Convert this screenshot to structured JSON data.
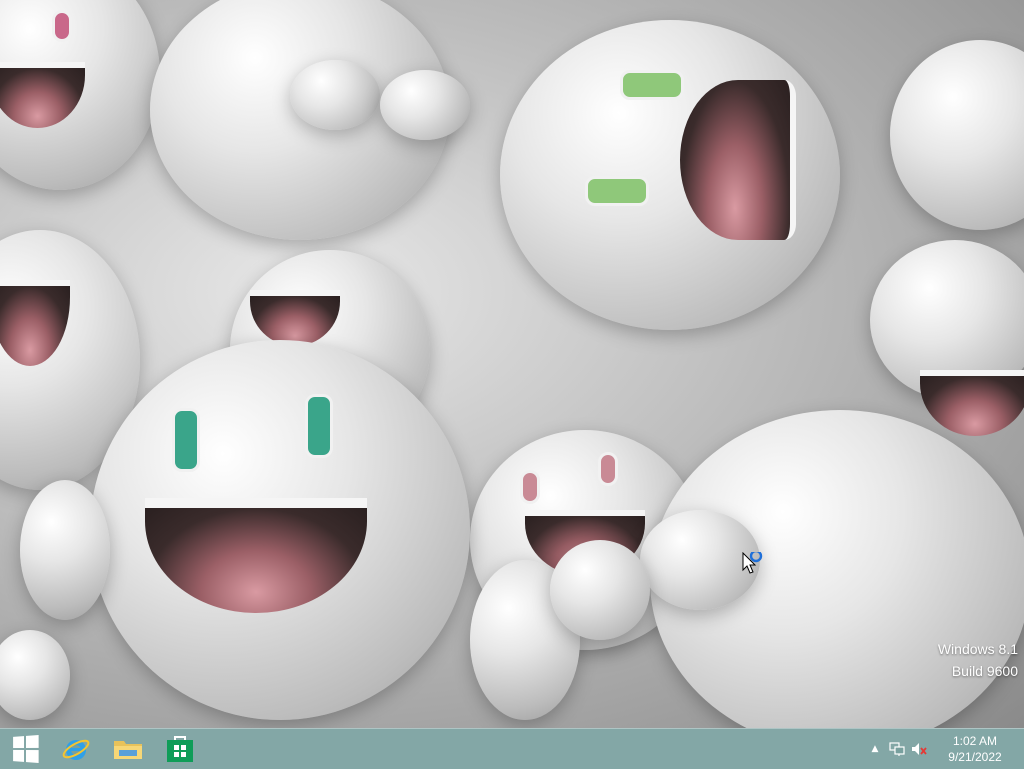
{
  "desktop": {
    "wallpaper": "white-glossy-figures-wallpaper",
    "watermark": {
      "line1": "Windows 8.1",
      "line2": "Build 9600"
    }
  },
  "taskbar": {
    "color": "#78a09e",
    "pinned": [
      {
        "name": "start-button",
        "icon": "windows-logo-icon"
      },
      {
        "name": "internet-explorer",
        "icon": "internet-explorer-icon"
      },
      {
        "name": "file-explorer",
        "icon": "folder-icon"
      },
      {
        "name": "store",
        "icon": "store-icon"
      }
    ],
    "tray": {
      "show_hidden_icon": "▲",
      "network_icon": "network-icon",
      "volume_icon": "volume-muted-icon",
      "time": "1:02 AM",
      "date": "9/21/2022"
    }
  },
  "cursor": {
    "icon": "busy-cursor-icon",
    "accent": "#1e6fd9"
  }
}
